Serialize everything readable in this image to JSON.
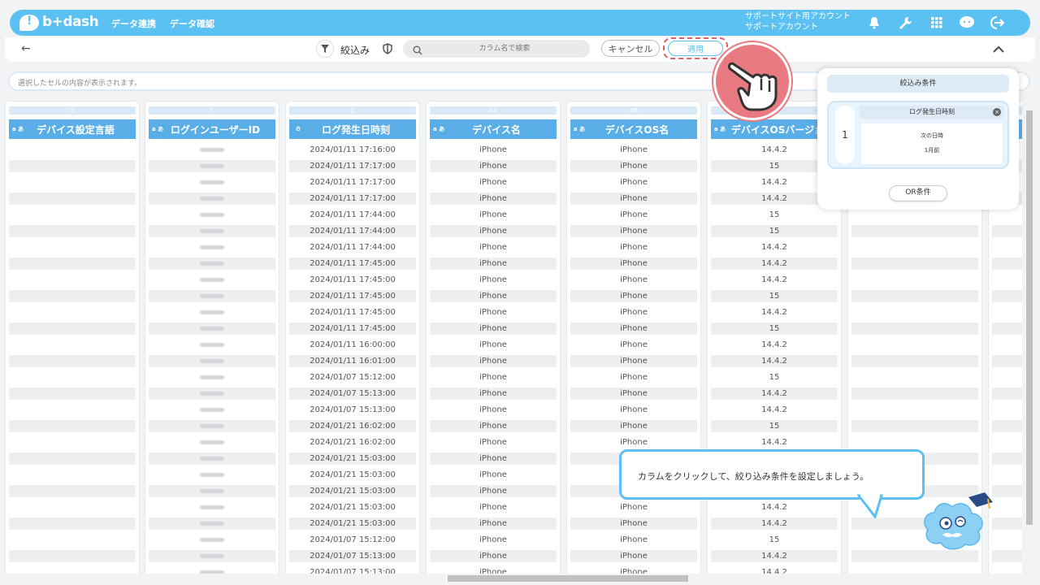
{
  "header": {
    "logo_text": "b+dash",
    "nav": [
      "データ連携",
      "データ確認"
    ],
    "account_line1": "サポートサイト用アカウント",
    "account_line2": "サポートアカウント",
    "icons": [
      "bell-icon",
      "wrench-icon",
      "apps-grid-icon",
      "help-bubble-icon",
      "logout-icon"
    ]
  },
  "toolbar": {
    "back": "←",
    "filter_label": "絞込み",
    "search_placeholder": "カラム名で検索",
    "cancel_label": "キャンセル",
    "apply_label": "適用",
    "collapse": "^"
  },
  "cellbar_placeholder": "選択したセルの内容が表示されます。",
  "columns": [
    {
      "letter": "X",
      "type": "a あ",
      "name": "デバイス設定言語"
    },
    {
      "letter": "Y",
      "type": "a あ",
      "name": "ログインユーザーID"
    },
    {
      "letter": "Z",
      "type": "⏱",
      "name": "ログ発生日時刻"
    },
    {
      "letter": "AA",
      "type": "a あ",
      "name": "デバイス名"
    },
    {
      "letter": "AB",
      "type": "a あ",
      "name": "デバイスOS名"
    },
    {
      "letter": "AC",
      "type": "a あ",
      "name": "デバイスOSバージョ"
    }
  ],
  "rows": [
    {
      "ts": "2024/01/11 17:16:00",
      "device": "iPhone",
      "os": "iPhone",
      "ver": "14.4.2"
    },
    {
      "ts": "2024/01/11 17:17:00",
      "device": "iPhone",
      "os": "iPhone",
      "ver": "15"
    },
    {
      "ts": "2024/01/11 17:17:00",
      "device": "iPhone",
      "os": "iPhone",
      "ver": "14.4.2"
    },
    {
      "ts": "2024/01/11 17:17:00",
      "device": "iPhone",
      "os": "iPhone",
      "ver": "14.4.2"
    },
    {
      "ts": "2024/01/11 17:44:00",
      "device": "iPhone",
      "os": "iPhone",
      "ver": "15"
    },
    {
      "ts": "2024/01/11 17:44:00",
      "device": "iPhone",
      "os": "iPhone",
      "ver": "15"
    },
    {
      "ts": "2024/01/11 17:44:00",
      "device": "iPhone",
      "os": "iPhone",
      "ver": "14.4.2"
    },
    {
      "ts": "2024/01/11 17:45:00",
      "device": "iPhone",
      "os": "iPhone",
      "ver": "14.4.2"
    },
    {
      "ts": "2024/01/11 17:45:00",
      "device": "iPhone",
      "os": "iPhone",
      "ver": "14.4.2"
    },
    {
      "ts": "2024/01/11 17:45:00",
      "device": "iPhone",
      "os": "iPhone",
      "ver": "15"
    },
    {
      "ts": "2024/01/11 17:45:00",
      "device": "iPhone",
      "os": "iPhone",
      "ver": "14.4.2"
    },
    {
      "ts": "2024/01/11 17:45:00",
      "device": "iPhone",
      "os": "iPhone",
      "ver": "15"
    },
    {
      "ts": "2024/01/11 16:00:00",
      "device": "iPhone",
      "os": "iPhone",
      "ver": "14.4.2"
    },
    {
      "ts": "2024/01/11 16:01:00",
      "device": "iPhone",
      "os": "iPhone",
      "ver": "14.4.2"
    },
    {
      "ts": "2024/01/07 15:12:00",
      "device": "iPhone",
      "os": "iPhone",
      "ver": "15"
    },
    {
      "ts": "2024/01/07 15:13:00",
      "device": "iPhone",
      "os": "iPhone",
      "ver": "14.4.2"
    },
    {
      "ts": "2024/01/07 15:13:00",
      "device": "iPhone",
      "os": "iPhone",
      "ver": "14.4.2"
    },
    {
      "ts": "2024/01/21 16:02:00",
      "device": "iPhone",
      "os": "iPhone",
      "ver": "15"
    },
    {
      "ts": "2024/01/21 16:02:00",
      "device": "iPhone",
      "os": "iPhone",
      "ver": "14.4.2"
    },
    {
      "ts": "2024/01/21 15:03:00",
      "device": "iPhone",
      "os": "",
      "ver": ""
    },
    {
      "ts": "2024/01/21 15:03:00",
      "device": "iPhone",
      "os": "",
      "ver": ""
    },
    {
      "ts": "2024/01/21 15:03:00",
      "device": "iPhone",
      "os": "",
      "ver": ""
    },
    {
      "ts": "2024/01/21 15:03:00",
      "device": "iPhone",
      "os": "iPhone",
      "ver": "14.4.2"
    },
    {
      "ts": "2024/01/21 15:03:00",
      "device": "iPhone",
      "os": "iPhone",
      "ver": "14.4.2"
    },
    {
      "ts": "2024/01/07 15:12:00",
      "device": "iPhone",
      "os": "iPhone",
      "ver": "15"
    },
    {
      "ts": "2024/01/07 15:13:00",
      "device": "iPhone",
      "os": "iPhone",
      "ver": "14.4.2"
    },
    {
      "ts": "2024/01/07 15:13:00",
      "device": "iPhone",
      "os": "iPhone",
      "ver": "14.4.2"
    }
  ],
  "filter_panel": {
    "title": "絞込み条件",
    "index": "1",
    "condition_column": "ログ発生日時刻",
    "condition_op": "次の日時",
    "condition_value": "1月前",
    "or_label": "OR条件"
  },
  "tooltip": "カラムをクリックして、絞り込み条件を設定しましょう。",
  "colors": {
    "brand": "#5bc0f2",
    "header_col": "#5aaee8",
    "highlight": "#e97a81"
  }
}
